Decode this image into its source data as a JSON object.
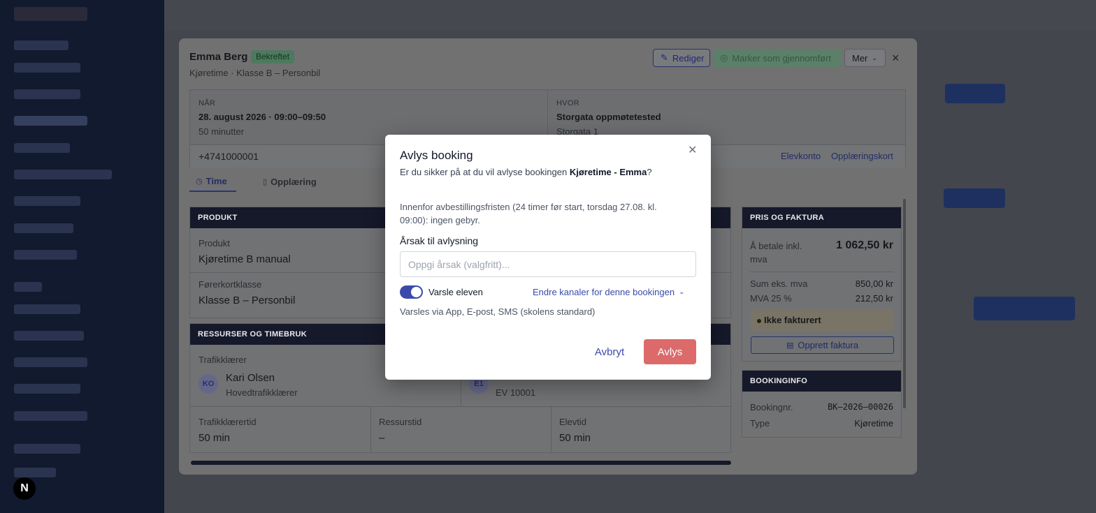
{
  "modal": {
    "student_name": "Emma Berg",
    "status_badge": "Bekreftet",
    "subtitle": "Kjøretime · Klasse B – Personbil",
    "edit_label": "Rediger",
    "complete_label": "Marker som gjennomført",
    "more_label": "Mer",
    "when": {
      "label": "NÅR",
      "value": "28. august 2026 · 09:00–09:50",
      "duration": "50 minutter"
    },
    "where": {
      "label": "HVOR",
      "value": "Storgata oppmøtetested",
      "address": "Storgata 1"
    },
    "phone": "+4741000001",
    "links": [
      "Elevkonto",
      "Opplæringskort"
    ],
    "tabs": [
      {
        "label": "Time"
      },
      {
        "label": "Opplæring"
      }
    ],
    "product": {
      "header": "PRODUKT",
      "product_label": "Produkt",
      "product_value": "Kjøretime B manual",
      "class_label": "Førerkortklasse",
      "class_value": "Klasse B – Personbil"
    },
    "resources": {
      "header": "RESSURSER OG TIMEBRUK",
      "instructor_label": "Trafikklærer",
      "instructor_initials": "KO",
      "instructor_name": "Kari Olsen",
      "instructor_role": "Hovedtrafikklærer",
      "vehicle_initials": "E1",
      "vehicle_sub": "EV 10001",
      "instructor_time_label": "Trafikklærertid",
      "instructor_time_value": "50 min",
      "resource_time_label": "Ressurstid",
      "resource_time_value": "–",
      "student_time_label": "Elevtid",
      "student_time_value": "50 min"
    },
    "pricing": {
      "header": "PRIS OG FAKTURA",
      "total_label_1": "Å betale inkl.",
      "total_label_2": "mva",
      "total_value": "1 062,50 kr",
      "sum_label": "Sum eks. mva",
      "sum_value": "850,00 kr",
      "vat_label": "MVA 25 %",
      "vat_value": "212,50 kr",
      "invoice_status": "Ikke fakturert",
      "create_invoice": "Opprett faktura"
    },
    "booking_info": {
      "header": "BOOKINGINFO",
      "number_label": "Bookingnr.",
      "number_value": "BK–2026–00026",
      "type_label": "Type",
      "type_value": "Kjøretime"
    }
  },
  "dialog": {
    "title": "Avlys booking",
    "question_prefix": "Er du sikker på at du vil avlyse bookingen ",
    "booking_name": "Kjøretime - Emma",
    "question_suffix": "?",
    "note": "Innenfor avbestillingsfristen (24 timer før start, torsdag 27.08. kl. 09:00): ingen gebyr.",
    "reason_label": "Årsak til avlysning",
    "reason_placeholder": "Oppgi årsak (valgfritt)...",
    "notify_label": "Varsle eleven",
    "notify_on": true,
    "channels_link": "Endre kanaler for denne bookingen",
    "channels_info": "Varsles via App, E-post, SMS (skolens standard)",
    "cancel_label": "Avbryt",
    "confirm_label": "Avlys"
  },
  "colors": {
    "accent": "#3b4aaa",
    "danger": "#dc6a6a",
    "card_header": "#15192a"
  }
}
